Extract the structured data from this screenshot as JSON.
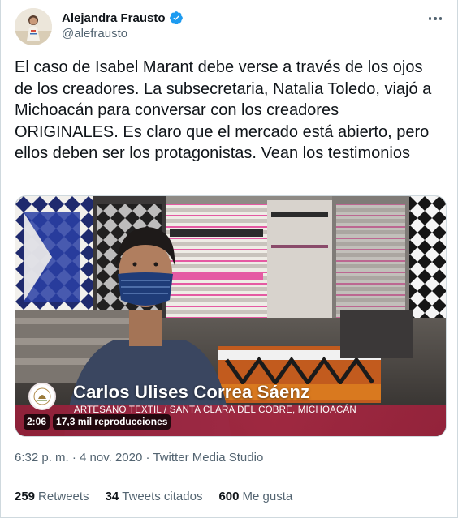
{
  "author": {
    "display_name": "Alejandra Frausto",
    "handle": "@alefrausto",
    "verified": true,
    "verified_color": "#1d9bf0"
  },
  "tweet": {
    "text": "El caso de Isabel Marant debe verse a través de los ojos de los creadores. La subsecretaria, Natalia Toledo, viajó a Michoacán para conversar con los creadores ORIGINALES. Es claro que el mercado está abierto, pero ellos deben ser los protagonistas. Vean los testimonios"
  },
  "media": {
    "lower_third_name": "Carlos Ulises Correa Sáenz",
    "lower_third_subtitle": "ARTESANO TEXTIL / SANTA CLARA DEL COBRE, MICHOACÁN",
    "duration": "2:06",
    "views": "17,3 mil reproducciones",
    "band_color": "#9a2240"
  },
  "meta": {
    "timestamp": "6:32 p. m. · 4 nov. 2020",
    "separator": " · ",
    "source": "Twitter Media Studio"
  },
  "stats": {
    "retweets_count": "259",
    "retweets_label": "Retweets",
    "quotes_count": "34",
    "quotes_label": "Tweets citados",
    "likes_count": "600",
    "likes_label": "Me gusta"
  },
  "icons": {
    "more": "more-dots-icon",
    "verified": "verified-badge-icon",
    "seal": "government-seal-icon"
  }
}
